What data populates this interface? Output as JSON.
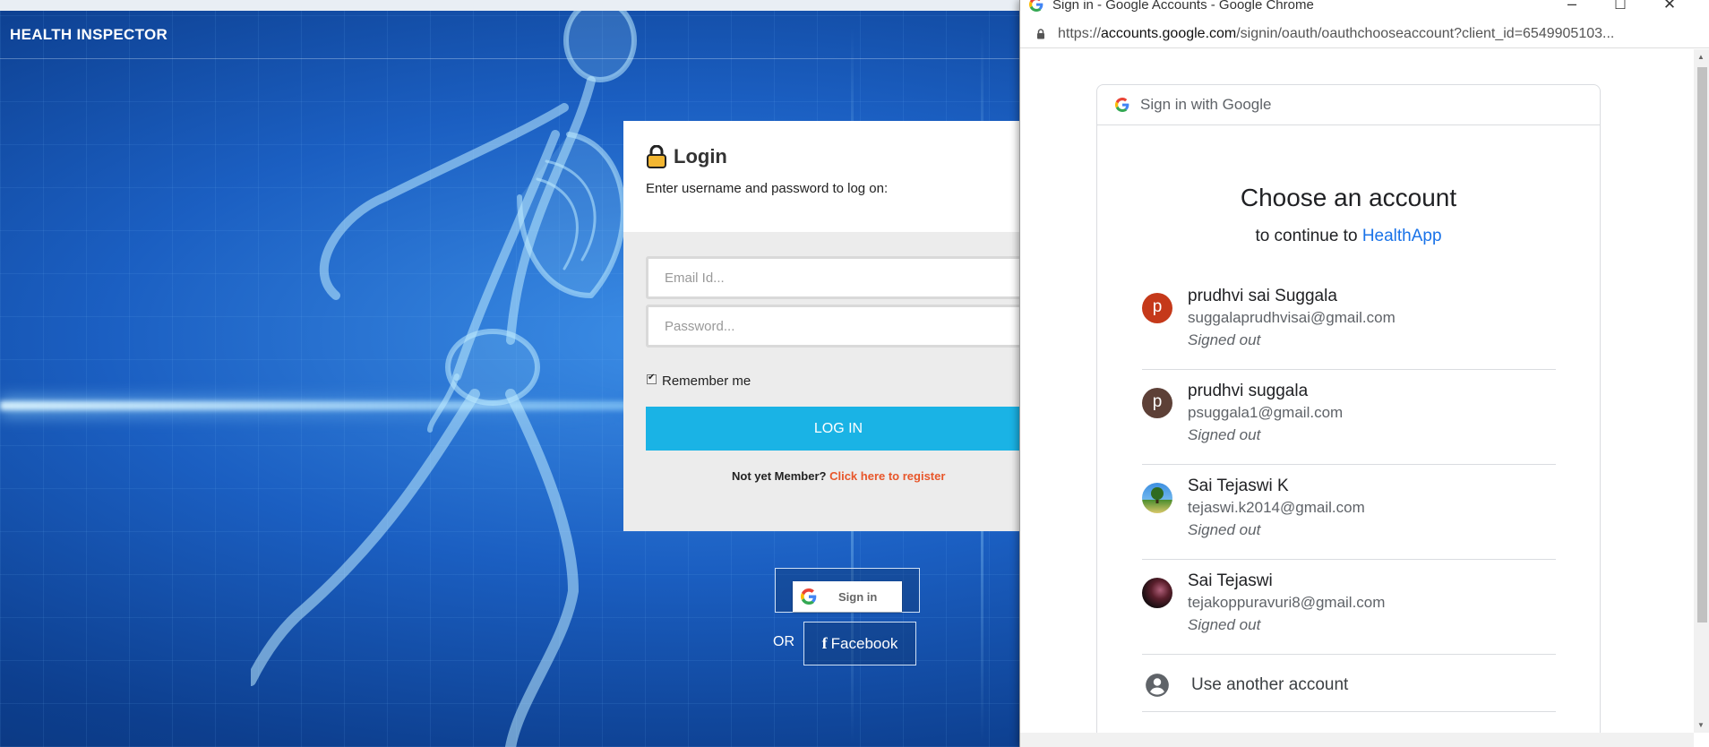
{
  "app": {
    "title": "HEALTH INSPECTOR"
  },
  "login": {
    "title": "Login",
    "subtitle": "Enter username and password to log on:",
    "email_placeholder": "Email Id...",
    "password_placeholder": "Password...",
    "remember_label": "Remember me",
    "login_button": "LOG IN",
    "register_prompt": "Not yet Member?",
    "register_link": "Click here to register"
  },
  "social": {
    "google_label": "Sign in",
    "or_text": "OR",
    "facebook_label": "Facebook",
    "facebook_icon": "f"
  },
  "popup": {
    "window_title": "Sign in - Google Accounts - Google Chrome",
    "url_prefix": "https://",
    "url_host": "accounts.google.com",
    "url_path": "/signin/oauth/oauthchooseaccount?client_id=6549905103...",
    "card_header": "Sign in with Google",
    "heading": "Choose an account",
    "continue_prefix": "to continue to",
    "app_name": "HealthApp",
    "accounts": [
      {
        "initial": "p",
        "name": "prudhvi sai Suggala",
        "email": "suggalaprudhvisai@gmail.com",
        "status": "Signed out",
        "color": "#c5391a"
      },
      {
        "initial": "p",
        "name": "prudhvi suggala",
        "email": "psuggala1@gmail.com",
        "status": "Signed out",
        "color": "#5d4037"
      },
      {
        "initial": "",
        "name": "Sai Tejaswi K",
        "email": "tejaswi.k2014@gmail.com",
        "status": "Signed out",
        "color": "#2e7bcf"
      },
      {
        "initial": "",
        "name": "Sai Tejaswi",
        "email": "tejakoppuravuri8@gmail.com",
        "status": "Signed out",
        "color": "#2a1a1a"
      }
    ],
    "use_another": "Use another account"
  },
  "colors": {
    "login_button": "#1ab3e5",
    "register_link": "#e8562a",
    "google_link": "#1a73e8"
  }
}
